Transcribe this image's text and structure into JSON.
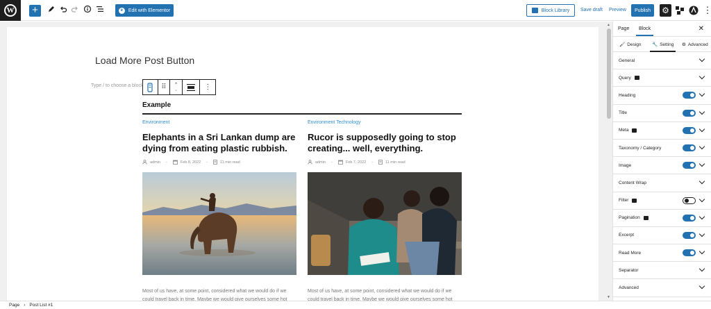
{
  "topbar": {
    "edit_elementor": "Edit with Elementor",
    "block_library": "Block Library",
    "save_draft": "Save draft",
    "preview": "Preview",
    "publish": "Publish"
  },
  "editor": {
    "page_title": "Load More Post Button",
    "placeholder": "Type / to choose a block"
  },
  "post_block": {
    "heading": "Example",
    "posts": [
      {
        "category": "Environment",
        "title": "Elephants in a Sri Lankan dump are dying from eating plastic rubbish.",
        "author": "admin",
        "date": "Feb 8, 2022",
        "read_time": "11 min read",
        "excerpt": "Most of us have, at some point, considered what we would do if we could travel back in time. Maybe we would give ourselves some hot"
      },
      {
        "category": "Environment Technology",
        "title": "Rucor is supposedly going to stop creating... well, everything.",
        "author": "admin",
        "date": "Feb 7, 2022",
        "read_time": "11 min read",
        "excerpt": "Most of us have, at some point, considered what we would do if we could travel back in time. Maybe we would give ourselves some hot"
      }
    ]
  },
  "sidebar": {
    "tabs": [
      "Page",
      "Block"
    ],
    "subtabs": [
      "Design",
      "Setting",
      "Advanced"
    ],
    "panels": [
      {
        "label": "General",
        "control": "chevron"
      },
      {
        "label": "Query",
        "video": true,
        "control": "chevron"
      },
      {
        "label": "Heading",
        "control": "toggle-on"
      },
      {
        "label": "Title",
        "control": "toggle-on"
      },
      {
        "label": "Meta",
        "video": true,
        "control": "toggle-on"
      },
      {
        "label": "Taxonomy / Category",
        "control": "toggle-on"
      },
      {
        "label": "Image",
        "control": "toggle-on"
      },
      {
        "label": "Content Wrap",
        "control": "chevron"
      },
      {
        "label": "Filter",
        "video": true,
        "control": "toggle-off"
      },
      {
        "label": "Pagination",
        "video": true,
        "control": "toggle-on"
      },
      {
        "label": "Excerpt",
        "control": "toggle-on"
      },
      {
        "label": "Read More",
        "control": "toggle-on"
      },
      {
        "label": "Separator",
        "control": "chevron"
      },
      {
        "label": "Advanced",
        "control": "chevron"
      }
    ]
  },
  "breadcrumb": {
    "root": "Page",
    "separator": "›",
    "current": "Post List #1"
  },
  "colors": {
    "accent": "#2271b1",
    "category": "#2f8fd8",
    "dark": "#1e1e1e"
  }
}
